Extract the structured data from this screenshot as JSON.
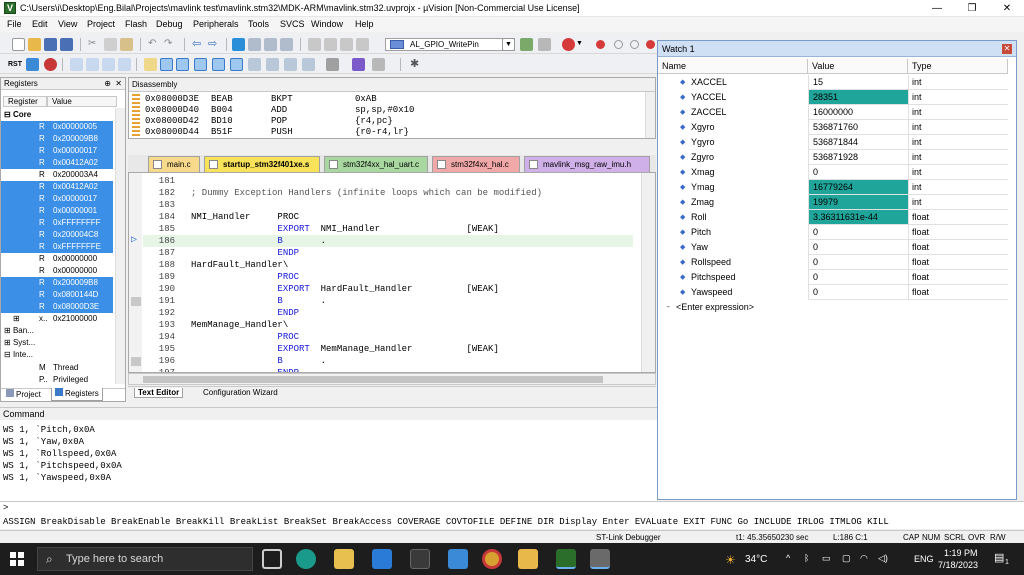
{
  "window": {
    "title": "C:\\Users\\i\\Desktop\\Eng.Bilal\\Projects\\mavlink test\\mavlink.stm32\\MDK-ARM\\mavlink.stm32.uvprojx - µVision  [Non-Commercial Use License]",
    "app_icon_letter": "V"
  },
  "menu": [
    "File",
    "Edit",
    "View",
    "Project",
    "Flash",
    "Debug",
    "Peripherals",
    "Tools",
    "SVCS",
    "Window",
    "Help"
  ],
  "toolbar": {
    "target_function": "AL_GPIO_WritePin",
    "reset_label": "RST"
  },
  "registers": {
    "title": "Registers",
    "col_register": "Register",
    "col_value": "Value",
    "group": "Core",
    "rows": [
      {
        "name": "R",
        "value": "0x00000005",
        "selected": true
      },
      {
        "name": "R",
        "value": "0x200009B8",
        "selected": true
      },
      {
        "name": "R",
        "value": "0x00000017",
        "selected": true
      },
      {
        "name": "R",
        "value": "0x00412A02",
        "selected": true
      },
      {
        "name": "R",
        "value": "0x200003A4",
        "selected": false
      },
      {
        "name": "R",
        "value": "0x00412A02",
        "selected": true
      },
      {
        "name": "R",
        "value": "0x00000017",
        "selected": true
      },
      {
        "name": "R",
        "value": "0x00000001",
        "selected": true
      },
      {
        "name": "R",
        "value": "0xFFFFFFFF",
        "selected": true
      },
      {
        "name": "R",
        "value": "0x200004C8",
        "selected": true
      },
      {
        "name": "R",
        "value": "0xFFFFFFFE",
        "selected": true
      },
      {
        "name": "R",
        "value": "0x00000000",
        "selected": false
      },
      {
        "name": "R",
        "value": "0x00000000",
        "selected": false
      },
      {
        "name": "R",
        "value": "0x200009B8",
        "selected": true
      },
      {
        "name": "R",
        "value": "0x0800144D",
        "selected": true
      },
      {
        "name": "R",
        "value": "0x08000D3E",
        "selected": true
      }
    ],
    "xpsr": {
      "name": "x..",
      "value": "0x21000000"
    },
    "tree": [
      "Ban...",
      "Syst...",
      "Inte..."
    ],
    "mode": [
      {
        "flag": "M",
        "value": "Thread"
      },
      {
        "flag": "P..",
        "value": "Privileged"
      }
    ],
    "tab_project": "Project",
    "tab_registers": "Registers"
  },
  "disassembly": {
    "title": "Disassembly",
    "rows": [
      {
        "addr": "0x08000D3E",
        "code": "BEAB",
        "op": "BKPT",
        "args": "0xAB"
      },
      {
        "addr": "0x08000D40",
        "code": "B004",
        "op": "ADD",
        "args": "sp,sp,#0x10"
      },
      {
        "addr": "0x08000D42",
        "code": "BD10",
        "op": "POP",
        "args": "{r4,pc}"
      },
      {
        "addr": "0x08000D44",
        "code": "B51F",
        "op": "PUSH",
        "args": "{r0-r4,lr}"
      }
    ]
  },
  "file_tabs": [
    "main.c",
    "startup_stm32f401xe.s",
    "stm32f4xx_hal_uart.c",
    "stm32f4xx_hal.c",
    "mavlink_msg_raw_imu.h"
  ],
  "editor": {
    "lines": [
      {
        "n": "181",
        "t": ""
      },
      {
        "n": "182",
        "t": "; Dummy Exception Handlers (infinite loops which can be modified)"
      },
      {
        "n": "183",
        "t": ""
      },
      {
        "n": "184",
        "t": "NMI_Handler     PROC"
      },
      {
        "n": "185",
        "t": "                EXPORT  NMI_Handler                [WEAK]"
      },
      {
        "n": "186",
        "t": "                B       ."
      },
      {
        "n": "187",
        "t": "                ENDP"
      },
      {
        "n": "188",
        "t": "HardFault_Handler\\"
      },
      {
        "n": "189",
        "t": "                PROC"
      },
      {
        "n": "190",
        "t": "                EXPORT  HardFault_Handler          [WEAK]"
      },
      {
        "n": "191",
        "t": "                B       ."
      },
      {
        "n": "192",
        "t": "                ENDP"
      },
      {
        "n": "193",
        "t": "MemManage_Handler\\"
      },
      {
        "n": "194",
        "t": "                PROC"
      },
      {
        "n": "195",
        "t": "                EXPORT  MemManage_Handler          [WEAK]"
      },
      {
        "n": "196",
        "t": "                B       ."
      },
      {
        "n": "197",
        "t": "                ENDP"
      }
    ],
    "tab_text_editor": "Text Editor",
    "tab_config": "Configuration Wizard"
  },
  "watch": {
    "title": "Watch 1",
    "col_name": "Name",
    "col_value": "Value",
    "col_type": "Type",
    "rows": [
      {
        "name": "XACCEL",
        "value": "15",
        "type": "int",
        "changed": false
      },
      {
        "name": "YACCEL",
        "value": "28351",
        "type": "int",
        "changed": true
      },
      {
        "name": "ZACCEL",
        "value": "16000000",
        "type": "int",
        "changed": false
      },
      {
        "name": "Xgyro",
        "value": "536871760",
        "type": "int",
        "changed": false
      },
      {
        "name": "Ygyro",
        "value": "536871844",
        "type": "int",
        "changed": false
      },
      {
        "name": "Zgyro",
        "value": "536871928",
        "type": "int",
        "changed": false
      },
      {
        "name": "Xmag",
        "value": "0",
        "type": "int",
        "changed": false
      },
      {
        "name": "Ymag",
        "value": "16779264",
        "type": "int",
        "changed": true
      },
      {
        "name": "Zmag",
        "value": "19979",
        "type": "int",
        "changed": true
      },
      {
        "name": "Roll",
        "value": "3.36311631e-44",
        "type": "float",
        "changed": true
      },
      {
        "name": "Pitch",
        "value": "0",
        "type": "float",
        "changed": false
      },
      {
        "name": "Yaw",
        "value": "0",
        "type": "float",
        "changed": false
      },
      {
        "name": "Rollspeed",
        "value": "0",
        "type": "float",
        "changed": false
      },
      {
        "name": "Pitchspeed",
        "value": "0",
        "type": "float",
        "changed": false
      },
      {
        "name": "Yawspeed",
        "value": "0",
        "type": "float",
        "changed": false
      }
    ],
    "enter_expression": "<Enter expression>"
  },
  "command": {
    "title": "Command",
    "lines": [
      "WS 1, `Pitch,0x0A",
      "WS 1, `Yaw,0x0A",
      "WS 1, `Rollspeed,0x0A",
      "WS 1, `Pitchspeed,0x0A",
      "WS 1, `Yawspeed,0x0A"
    ],
    "prompt": ">",
    "help": "ASSIGN BreakDisable BreakEnable BreakKill BreakList BreakSet BreakAccess COVERAGE COVTOFILE DEFINE DIR Display Enter EVALuate EXIT FUNC Go INCLUDE IRLOG ITMLOG KILL"
  },
  "status": {
    "debugger": "ST-Link Debugger",
    "time": "t1: 45.35650230 sec",
    "cursor": "L:186 C:1",
    "flags": [
      "CAP",
      "NUM",
      "SCRL",
      "OVR",
      "R/W"
    ]
  },
  "taskbar": {
    "search_placeholder": "Type here to search",
    "temperature": "34°C",
    "language": "ENG",
    "time": "1:19 PM",
    "date": "7/18/2023",
    "notifications": "1"
  },
  "colors": {
    "selection": "#3b8fe6",
    "changed_value": "#1fa59a",
    "keyword": "#1b1bd6",
    "taskbar": "#1d1d1d"
  }
}
